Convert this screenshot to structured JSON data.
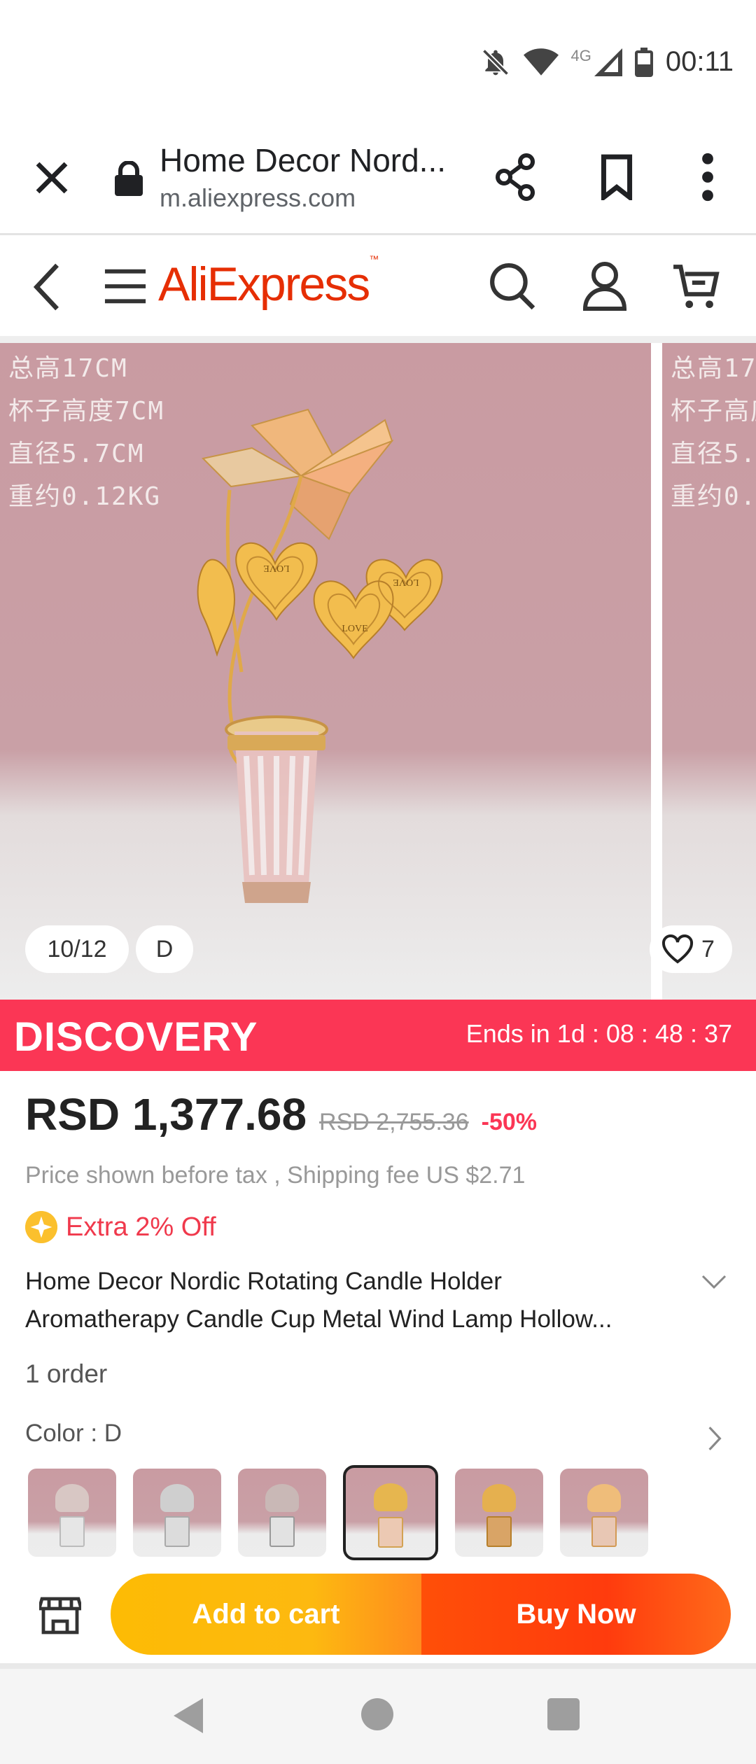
{
  "status_bar": {
    "time": "00:11",
    "network": "4G"
  },
  "browser": {
    "title": "Home Decor Nord...",
    "url": "m.aliexpress.com"
  },
  "site_header": {
    "logo": "AliExpress",
    "logo_mark": "™"
  },
  "gallery": {
    "specs": [
      "总高17CM",
      "杯子高度7CM",
      "直径5.7CM",
      "重约0.12KG"
    ],
    "heart_labels": [
      "LOVE",
      "LOVE",
      "LOVE"
    ],
    "image_counter": "10/12",
    "variant_label": "D",
    "wishlist_count": "7"
  },
  "promo": {
    "banner": "DISCOVERY",
    "timer": "Ends in 1d : 08 : 48 : 37",
    "color": "#fb3655"
  },
  "product": {
    "price": "RSD 1,377.68",
    "original_price": "RSD 2,755.36",
    "discount": "-50%",
    "tax_shipping": "Price shown before tax , Shipping fee US $2.71",
    "extra_off": "Extra 2% Off",
    "title": "Home Decor Nordic Rotating Candle Holder Aromatherapy Candle Cup Metal Wind Lamp Hollow...",
    "orders": "1 order",
    "color_label": "Color : D",
    "selected_thumb": 3,
    "thumbnail_count": 6
  },
  "actions": {
    "add_to_cart": "Add to cart",
    "buy_now": "Buy Now"
  },
  "colors": {
    "aliexpress_red": "#e62e04",
    "add_to_cart": "#fdbb04",
    "buy_now": "#ff4f08"
  }
}
